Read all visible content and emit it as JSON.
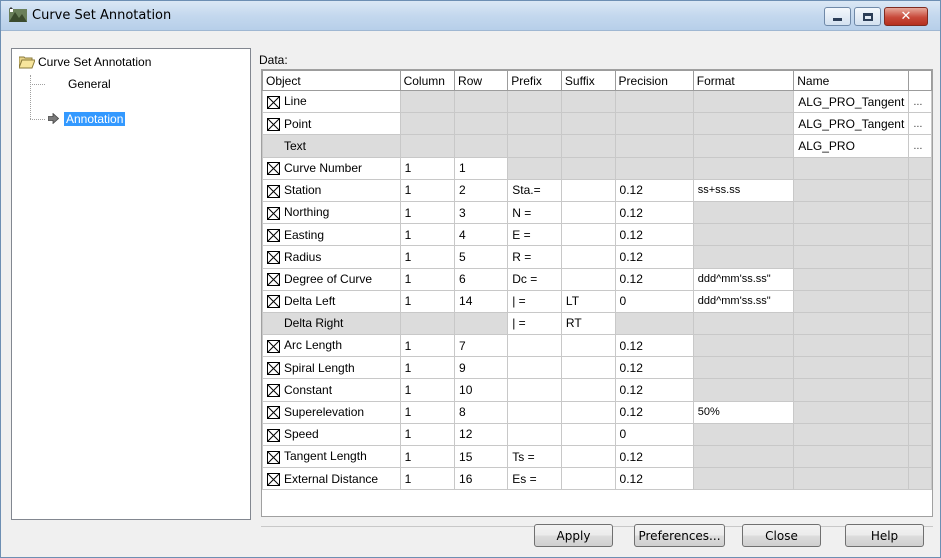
{
  "window": {
    "title": "Curve Set Annotation"
  },
  "tree": {
    "root_label": "Curve Set Annotation",
    "items": [
      {
        "label": "General",
        "selected": false
      },
      {
        "label": "Annotation",
        "selected": true
      }
    ]
  },
  "data_label": "Data:",
  "grid": {
    "columns": [
      "Object",
      "Column",
      "Row",
      "Prefix",
      "Suffix",
      "Precision",
      "Format",
      "Name",
      ""
    ],
    "rows": [
      {
        "checked": true,
        "object": "Line",
        "column": "",
        "row": "",
        "prefix": "",
        "suffix": "",
        "precision": "",
        "format": "",
        "name": "ALG_PRO_Tangent",
        "more": "..."
      },
      {
        "checked": true,
        "object": "Point",
        "column": "",
        "row": "",
        "prefix": "",
        "suffix": "",
        "precision": "",
        "format": "",
        "name": "ALG_PRO_Tangent",
        "more": "..."
      },
      {
        "checked": false,
        "object": "Text",
        "column": "",
        "row": "",
        "prefix": "",
        "suffix": "",
        "precision": "",
        "format": "",
        "name": "ALG_PRO",
        "more": "..."
      },
      {
        "checked": true,
        "object": "Curve Number",
        "column": "1",
        "row": "1",
        "prefix": "",
        "suffix": "",
        "precision": "",
        "format": "",
        "name": "",
        "more": ""
      },
      {
        "checked": true,
        "object": "Station",
        "column": "1",
        "row": "2",
        "prefix": "Sta.=",
        "suffix": "",
        "precision": "0.12",
        "format": "ss+ss.ss",
        "name": "",
        "more": ""
      },
      {
        "checked": true,
        "object": "Northing",
        "column": "1",
        "row": "3",
        "prefix": "N =",
        "suffix": "",
        "precision": "0.12",
        "format": "",
        "name": "",
        "more": ""
      },
      {
        "checked": true,
        "object": "Easting",
        "column": "1",
        "row": "4",
        "prefix": "E =",
        "suffix": "",
        "precision": "0.12",
        "format": "",
        "name": "",
        "more": ""
      },
      {
        "checked": true,
        "object": "Radius",
        "column": "1",
        "row": "5",
        "prefix": "R =",
        "suffix": "",
        "precision": "0.12",
        "format": "",
        "name": "",
        "more": ""
      },
      {
        "checked": true,
        "object": "Degree of Curve",
        "column": "1",
        "row": "6",
        "prefix": "Dc =",
        "suffix": "",
        "precision": "0.12",
        "format": "ddd^mm'ss.ss\"",
        "name": "",
        "more": ""
      },
      {
        "checked": true,
        "object": "Delta Left",
        "column": "1",
        "row": "14",
        "prefix": "| =",
        "suffix": "LT",
        "precision": "0",
        "format": "ddd^mm'ss.ss\"",
        "name": "",
        "more": ""
      },
      {
        "checked": false,
        "object": "Delta Right",
        "column": "",
        "row": "",
        "prefix": "| =",
        "suffix": "RT",
        "precision": "",
        "format": "",
        "name": "",
        "more": ""
      },
      {
        "checked": true,
        "object": "Arc Length",
        "column": "1",
        "row": "7",
        "prefix": "",
        "suffix": "",
        "precision": "0.12",
        "format": "",
        "name": "",
        "more": ""
      },
      {
        "checked": true,
        "object": "Spiral Length",
        "column": "1",
        "row": "9",
        "prefix": "",
        "suffix": "",
        "precision": "0.12",
        "format": "",
        "name": "",
        "more": ""
      },
      {
        "checked": true,
        "object": "Constant",
        "column": "1",
        "row": "10",
        "prefix": "",
        "suffix": "",
        "precision": "0.12",
        "format": "",
        "name": "",
        "more": ""
      },
      {
        "checked": true,
        "object": "Superelevation",
        "column": "1",
        "row": "8",
        "prefix": "",
        "suffix": "",
        "precision": "0.12",
        "format": "50%",
        "name": "",
        "more": ""
      },
      {
        "checked": true,
        "object": "Speed",
        "column": "1",
        "row": "12",
        "prefix": "",
        "suffix": "",
        "precision": "0",
        "format": "",
        "name": "",
        "more": ""
      },
      {
        "checked": true,
        "object": "Tangent Length",
        "column": "1",
        "row": "15",
        "prefix": "Ts =",
        "suffix": "",
        "precision": "0.12",
        "format": "",
        "name": "",
        "more": ""
      },
      {
        "checked": true,
        "object": "External Distance",
        "column": "1",
        "row": "16",
        "prefix": "Es =",
        "suffix": "",
        "precision": "0.12",
        "format": "",
        "name": "",
        "more": ""
      }
    ]
  },
  "buttons": {
    "apply": "Apply",
    "preferences": "Preferences...",
    "close": "Close",
    "help": "Help"
  }
}
